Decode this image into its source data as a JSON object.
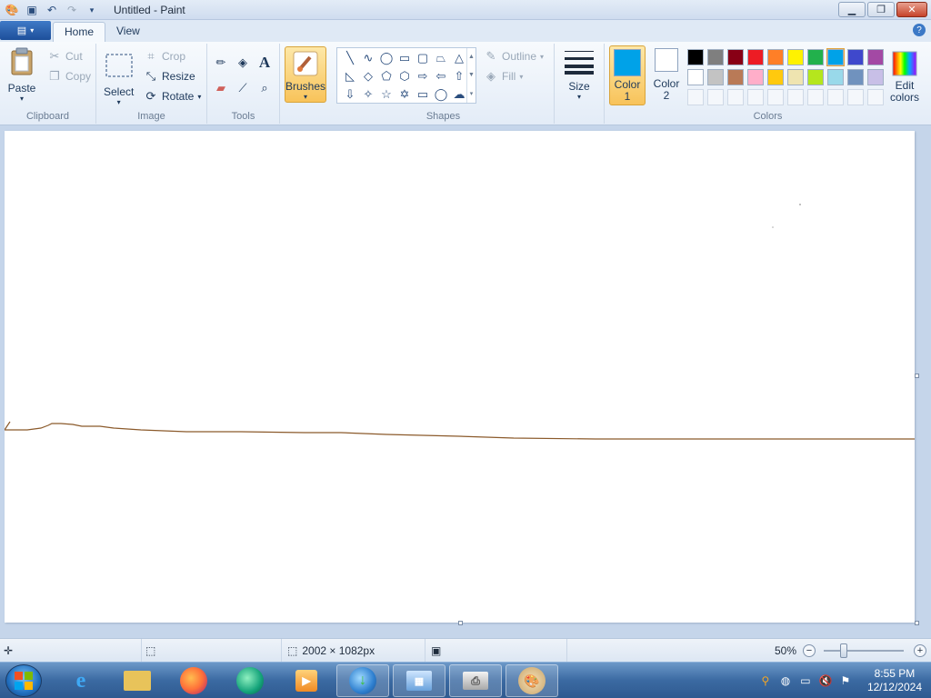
{
  "window": {
    "title": "Untitled - Paint"
  },
  "tabs": [
    {
      "label": "Home"
    },
    {
      "label": "View"
    }
  ],
  "clipboard": {
    "paste": "Paste",
    "cut": "Cut",
    "copy": "Copy",
    "group": "Clipboard"
  },
  "image": {
    "select": "Select",
    "crop": "Crop",
    "resize": "Resize",
    "rotate": "Rotate",
    "group": "Image"
  },
  "tools": {
    "group": "Tools",
    "brushes": "Brushes"
  },
  "shapes": {
    "group": "Shapes",
    "outline": "Outline",
    "fill": "Fill"
  },
  "size": {
    "label": "Size"
  },
  "colors": {
    "group": "Colors",
    "color1_label": "Color",
    "color1_num": "1",
    "color2_label": "Color",
    "color2_num": "2",
    "edit": "Edit colors",
    "color1_value": "#00a2e8",
    "color2_value": "#ffffff",
    "row1": [
      "#000000",
      "#7f7f7f",
      "#880015",
      "#ed1c24",
      "#ff7f27",
      "#fff200",
      "#22b14c",
      "#00a2e8",
      "#3f48cc",
      "#a349a4"
    ],
    "row2": [
      "#ffffff",
      "#c3c3c3",
      "#b97a57",
      "#ffaec9",
      "#ffc90e",
      "#efe4b0",
      "#b5e61d",
      "#99d9ea",
      "#7092be",
      "#c8bfe7"
    ]
  },
  "canvas": {
    "stroke_color": "#8b5a2b"
  },
  "status": {
    "dimensions": "2002 × 1082px",
    "zoom": "50%"
  },
  "taskbar": {
    "time": "8:55 PM",
    "date": "12/12/2024"
  }
}
